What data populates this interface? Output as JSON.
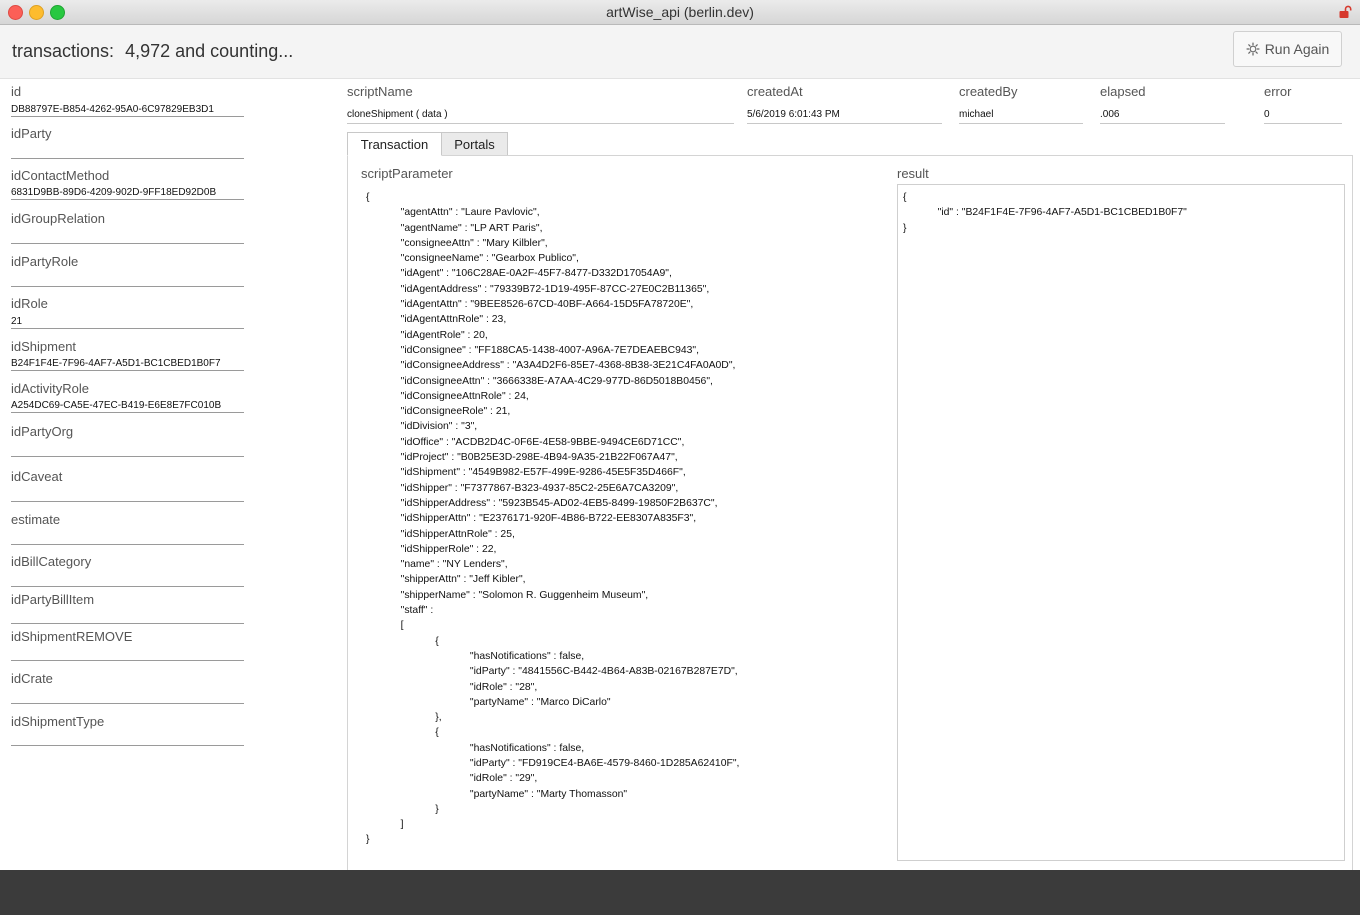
{
  "window": {
    "title": "artWise_api (berlin.dev)"
  },
  "header": {
    "label": "transactions:",
    "count": "4,972 and counting...",
    "run_again_label": "Run Again"
  },
  "left_fields": [
    {
      "label": "id",
      "value": "DB88797E-B854-4262-95A0-6C97829EB3D1"
    },
    {
      "label": "idParty",
      "value": ""
    },
    {
      "label": "idContactMethod",
      "value": "6831D9BB-89D6-4209-902D-9FF18ED92D0B"
    },
    {
      "label": "idGroupRelation",
      "value": ""
    },
    {
      "label": "idPartyRole",
      "value": ""
    },
    {
      "label": "idRole",
      "value": "21"
    },
    {
      "label": "idShipment",
      "value": "B24F1F4E-7F96-4AF7-A5D1-BC1CBED1B0F7"
    },
    {
      "label": "idActivityRole",
      "value": "A254DC69-CA5E-47EC-B419-E6E8E7FC010B"
    },
    {
      "label": "idPartyOrg",
      "value": ""
    },
    {
      "label": "idCaveat",
      "value": ""
    },
    {
      "label": "estimate",
      "value": ""
    },
    {
      "label": "idBillCategory",
      "value": ""
    },
    {
      "label": "idPartyBillItem",
      "value": ""
    },
    {
      "label": "idShipmentREMOVE",
      "value": ""
    },
    {
      "label": "idCrate",
      "value": ""
    },
    {
      "label": "idShipmentType",
      "value": ""
    }
  ],
  "meta": {
    "scriptName": {
      "label": "scriptName",
      "value": "cloneShipment ( data )"
    },
    "createdAt": {
      "label": "createdAt",
      "value": "5/6/2019 6:01:43 PM"
    },
    "createdBy": {
      "label": "createdBy",
      "value": "michael"
    },
    "elapsed": {
      "label": "elapsed",
      "value": ".006"
    },
    "error": {
      "label": "error",
      "value": "0"
    }
  },
  "tabs": [
    {
      "label": "Transaction",
      "active": true
    },
    {
      "label": "Portals",
      "active": false
    }
  ],
  "panel": {
    "param_label": "scriptParameter",
    "result_label": "result",
    "script_parameter": "{\n            \"agentAttn\" : \"Laure Pavlovic\",\n            \"agentName\" : \"LP ART Paris\",\n            \"consigneeAttn\" : \"Mary Kilbler\",\n            \"consigneeName\" : \"Gearbox Publico\",\n            \"idAgent\" : \"106C28AE-0A2F-45F7-8477-D332D17054A9\",\n            \"idAgentAddress\" : \"79339B72-1D19-495F-87CC-27E0C2B11365\",\n            \"idAgentAttn\" : \"9BEE8526-67CD-40BF-A664-15D5FA78720E\",\n            \"idAgentAttnRole\" : 23,\n            \"idAgentRole\" : 20,\n            \"idConsignee\" : \"FF188CA5-1438-4007-A96A-7E7DEAEBC943\",\n            \"idConsigneeAddress\" : \"A3A4D2F6-85E7-4368-8B38-3E21C4FA0A0D\",\n            \"idConsigneeAttn\" : \"3666338E-A7AA-4C29-977D-86D5018B0456\",\n            \"idConsigneeAttnRole\" : 24,\n            \"idConsigneeRole\" : 21,\n            \"idDivision\" : \"3\",\n            \"idOffice\" : \"ACDB2D4C-0F6E-4E58-9BBE-9494CE6D71CC\",\n            \"idProject\" : \"B0B25E3D-298E-4B94-9A35-21B22F067A47\",\n            \"idShipment\" : \"4549B982-E57F-499E-9286-45E5F35D466F\",\n            \"idShipper\" : \"F7377867-B323-4937-85C2-25E6A7CA3209\",\n            \"idShipperAddress\" : \"5923B545-AD02-4EB5-8499-19850F2B637C\",\n            \"idShipperAttn\" : \"E2376171-920F-4B86-B722-EE8307A835F3\",\n            \"idShipperAttnRole\" : 25,\n            \"idShipperRole\" : 22,\n            \"name\" : \"NY Lenders\",\n            \"shipperAttn\" : \"Jeff Kibler\",\n            \"shipperName\" : \"Solomon R. Guggenheim Museum\",\n            \"staff\" :\n            [\n                        {\n                                    \"hasNotifications\" : false,\n                                    \"idParty\" : \"4841556C-B442-4B64-A83B-02167B287E7D\",\n                                    \"idRole\" : \"28\",\n                                    \"partyName\" : \"Marco DiCarlo\"\n                        },\n                        {\n                                    \"hasNotifications\" : false,\n                                    \"idParty\" : \"FD919CE4-BA6E-4579-8460-1D285A62410F\",\n                                    \"idRole\" : \"29\",\n                                    \"partyName\" : \"Marty Thomasson\"\n                        }\n            ]\n}",
    "result": "{\n            \"id\" : \"B24F1F4E-7F96-4AF7-A5D1-BC1CBED1B0F7\"\n}"
  },
  "colors": {
    "close": "#fc5f57",
    "minimize": "#fdbc2e",
    "zoom": "#28c840",
    "lock": "#d63a2f",
    "footer": "#3b3b3b"
  },
  "icons": {
    "run": "gear-icon",
    "lock": "lock-icon"
  }
}
